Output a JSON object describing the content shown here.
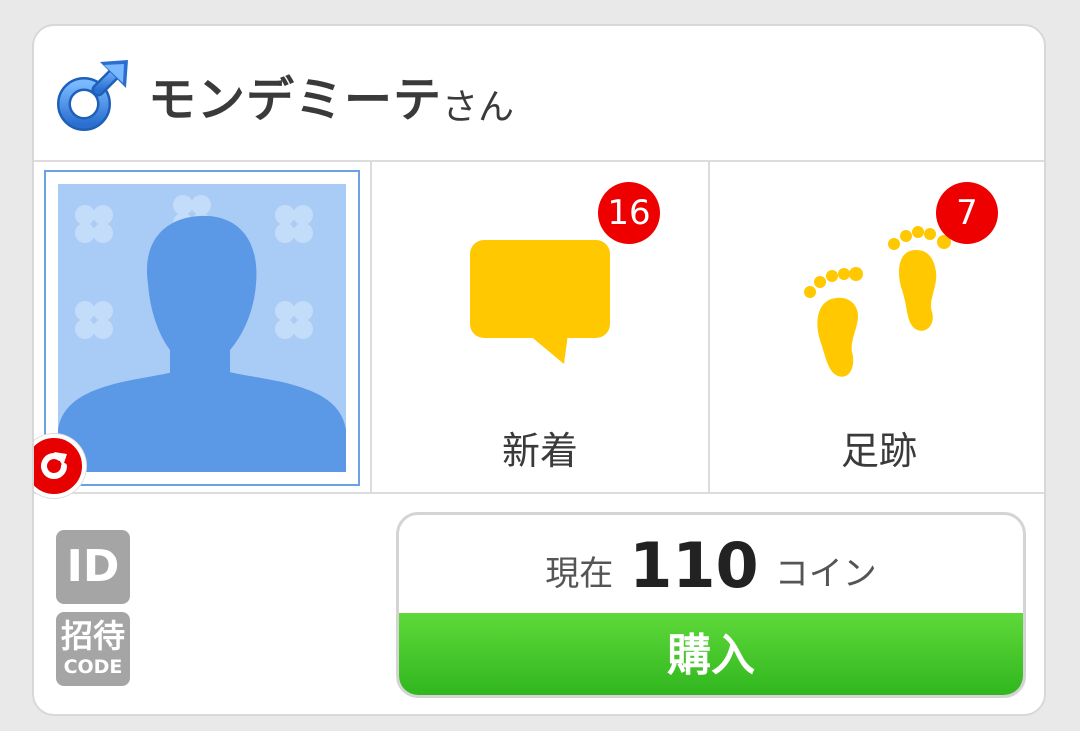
{
  "header": {
    "user_name": "モンデミーテ",
    "honorific": "さん",
    "gender_icon": "male-symbol-icon"
  },
  "tiles": {
    "new": {
      "label": "新着",
      "count": "16",
      "icon": "speech-bubble-icon"
    },
    "footprints": {
      "label": "足跡",
      "count": "7",
      "icon": "footprints-icon"
    }
  },
  "avatar": {
    "icon": "default-male-avatar",
    "refresh_icon": "refresh-icon"
  },
  "side_badges": {
    "id_label": "ID",
    "invite_top": "招待",
    "invite_bottom": "CODE"
  },
  "coins": {
    "prefix": "現在",
    "count": "110",
    "unit": "コイン",
    "buy_label": "購入"
  },
  "colors": {
    "accent_green": "#3fc62a",
    "badge_red": "#ee0000",
    "icon_yellow": "#ffc800",
    "male_blue": "#3a86e0",
    "avatar_bg": "#a9ccf7"
  }
}
